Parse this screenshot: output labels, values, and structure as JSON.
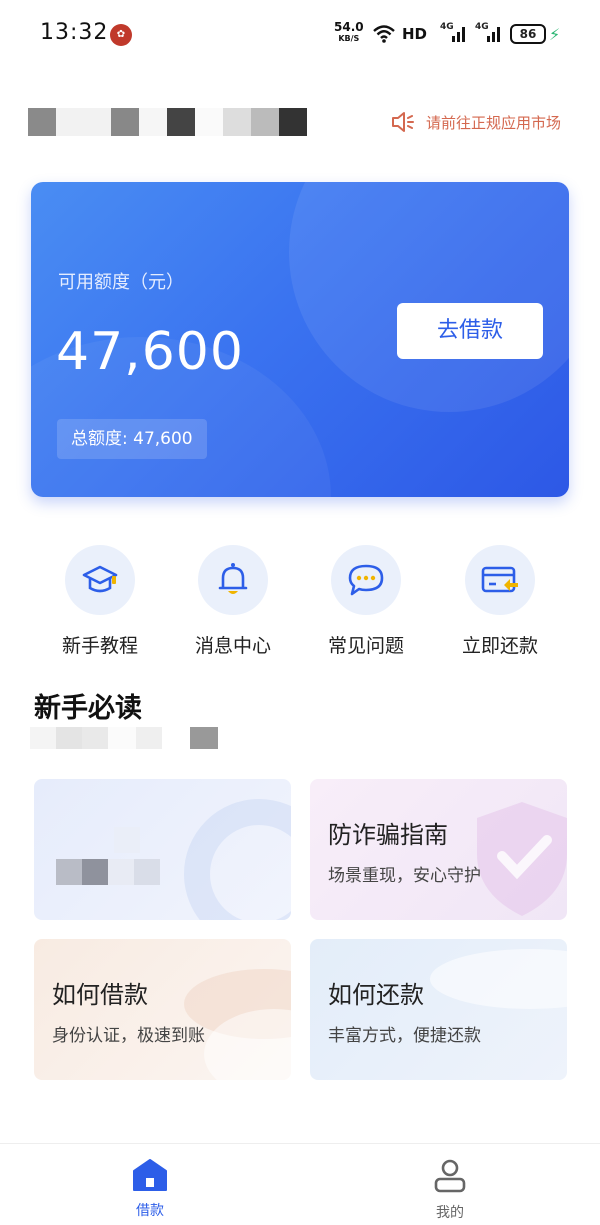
{
  "status_bar": {
    "time": "13:32",
    "net_speed": "54.0",
    "net_unit": "KB/S",
    "hd": "HD",
    "sig1": "4G",
    "sig2": "4G",
    "battery": "86"
  },
  "notice": {
    "text": "请前往正规应用市场",
    "color": "#d4684f"
  },
  "card": {
    "label": "可用额度（元）",
    "amount": "47,600",
    "total": "总额度: 47,600",
    "button": "去借款",
    "accent": "#2d5ee8"
  },
  "quick_menu": [
    {
      "label": "新手教程",
      "icon": "graduation-cap-icon"
    },
    {
      "label": "消息中心",
      "icon": "bell-icon"
    },
    {
      "label": "常见问题",
      "icon": "chat-bubble-icon"
    },
    {
      "label": "立即还款",
      "icon": "card-repay-icon"
    }
  ],
  "section": {
    "title": "新手必读"
  },
  "tiles": [
    {
      "title": "",
      "subtitle": ""
    },
    {
      "title": "防诈骗指南",
      "subtitle": "场景重现，安心守护"
    },
    {
      "title": "如何借款",
      "subtitle": "身份认证，极速到账"
    },
    {
      "title": "如何还款",
      "subtitle": "丰富方式，便捷还款"
    }
  ],
  "bottom_nav": [
    {
      "label": "借款",
      "icon": "home-icon",
      "active": true
    },
    {
      "label": "我的",
      "icon": "user-icon",
      "active": false
    }
  ]
}
